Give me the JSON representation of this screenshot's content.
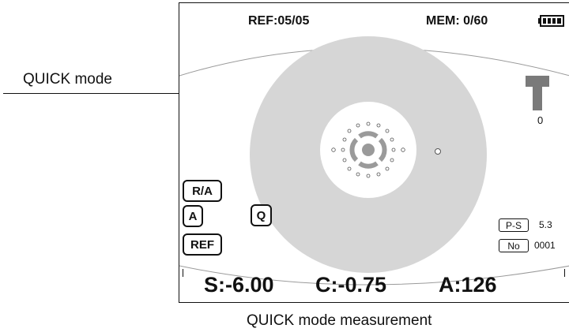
{
  "callout": {
    "label": "QUICK mode"
  },
  "status_bar": {
    "ref": "REF:05/05",
    "mem": "MEM: 0/60",
    "battery_icon": "battery-full-icon"
  },
  "right_panel": {
    "stage_icon": "t-stage-icon",
    "stage_value": "0",
    "ps_tag": "P-S",
    "ps_value": "5.3",
    "no_tag": "No",
    "no_value": "0001"
  },
  "buttons": {
    "ra": "R/A",
    "a": "A",
    "q": "Q",
    "ref": "REF"
  },
  "readings": {
    "s": "S:-6.00",
    "c": "C:-0.75",
    "a": "A:126"
  },
  "caption": "QUICK mode measurement",
  "colors": {
    "disc": "#d6d6d6",
    "stage_icon": "#7a7a7a",
    "text": "#111111"
  }
}
